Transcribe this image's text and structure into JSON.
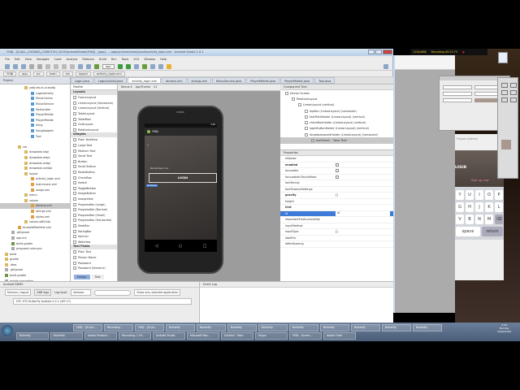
{
  "window": {
    "title": "YOBJ - [D:\\ALL_CODING\\_CODE\\TUH_2015\\AndroidStudio\\YOBJ] - [app] - ...\\app\\src\\main\\res\\layout\\activity_login.xml - Android Studio 1.0.1"
  },
  "menu": [
    "File",
    "Edit",
    "View",
    "Navigate",
    "Code",
    "Analyze",
    "Refactor",
    "Build",
    "Run",
    "Tools",
    "VCS",
    "Window",
    "Help"
  ],
  "toolbar": {
    "run_config": "app"
  },
  "breadcrumb": [
    "YOBJ",
    "app",
    "src",
    "main",
    "res",
    "layout",
    "activity_login.xml"
  ],
  "editor_tabs": [
    {
      "label": "Login.java",
      "active": false
    },
    {
      "label": "LoginActivity.java",
      "active": false
    },
    {
      "label": "activity_login.xml",
      "active": true
    },
    {
      "label": "dimens.xml",
      "active": false
    },
    {
      "label": "strings.xml",
      "active": false
    },
    {
      "label": "MusicService.java",
      "active": false
    },
    {
      "label": "PlayerMiddle.java",
      "active": false
    },
    {
      "label": "PlayerMiddle.java",
      "active": false
    },
    {
      "label": "Tool.java",
      "active": false
    }
  ],
  "project": {
    "header": "Project",
    "items": [
      {
        "label": "yobj.ew.cs.ui.eyobj",
        "depth": 3,
        "type": "folder"
      },
      {
        "label": "LoginActivity",
        "depth": 4,
        "type": "class"
      },
      {
        "label": "MusicCenter",
        "depth": 4,
        "type": "class"
      },
      {
        "label": "MusicService",
        "depth": 4,
        "type": "class"
      },
      {
        "label": "MyHandler",
        "depth": 4,
        "type": "class"
      },
      {
        "label": "PlayerMiddle",
        "depth": 4,
        "type": "class"
      },
      {
        "label": "PlayerMiddle",
        "depth": 4,
        "type": "class"
      },
      {
        "label": "Song",
        "depth": 4,
        "type": "class"
      },
      {
        "label": "SongAdapter",
        "depth": 4,
        "type": "class"
      },
      {
        "label": "Tool",
        "depth": 4,
        "type": "class"
      },
      {
        "label": "",
        "depth": 0,
        "type": "spacer"
      },
      {
        "label": "res",
        "depth": 2,
        "type": "folder"
      },
      {
        "label": "drawable-hdpi",
        "depth": 3,
        "type": "folder"
      },
      {
        "label": "drawable-mdpi",
        "depth": 3,
        "type": "folder"
      },
      {
        "label": "drawable-xhdpi",
        "depth": 3,
        "type": "folder"
      },
      {
        "label": "drawable-xxhdpi",
        "depth": 3,
        "type": "folder"
      },
      {
        "label": "layout",
        "depth": 3,
        "type": "folder"
      },
      {
        "label": "activity_login.xml",
        "depth": 4,
        "type": "xml"
      },
      {
        "label": "mainmusic.xml",
        "depth": 4,
        "type": "xml"
      },
      {
        "label": "songs.xml",
        "depth": 4,
        "type": "xml"
      },
      {
        "label": "menu",
        "depth": 3,
        "type": "folder"
      },
      {
        "label": "values",
        "depth": 3,
        "type": "folder"
      },
      {
        "label": "dimens.xml",
        "depth": 4,
        "type": "xml",
        "selected": true
      },
      {
        "label": "strings.xml",
        "depth": 4,
        "type": "xml"
      },
      {
        "label": "styles.xml",
        "depth": 4,
        "type": "xml"
      },
      {
        "label": "values-w820dp",
        "depth": 3,
        "type": "folder"
      },
      {
        "label": "AndroidManifest.xml",
        "depth": 2,
        "type": "xml"
      },
      {
        "label": ".gitignore",
        "depth": 1,
        "type": "file"
      },
      {
        "label": "app.iml",
        "depth": 1,
        "type": "file"
      },
      {
        "label": "build.gradle",
        "depth": 1,
        "type": "gradle"
      },
      {
        "label": "proguard-rules.pro",
        "depth": 1,
        "type": "file"
      },
      {
        "label": "build",
        "depth": 0,
        "type": "folder"
      },
      {
        "label": "gradle",
        "depth": 0,
        "type": "folder"
      },
      {
        "label": ".idea",
        "depth": 0,
        "type": "folder"
      },
      {
        "label": ".gitignore",
        "depth": 0,
        "type": "file"
      },
      {
        "label": "build.gradle",
        "depth": 0,
        "type": "gradle"
      },
      {
        "label": "gradle.properties",
        "depth": 0,
        "type": "file"
      },
      {
        "label": "gradlew",
        "depth": 0,
        "type": "file"
      }
    ]
  },
  "palette": {
    "header": "Palette",
    "sections": [
      {
        "title": "Layouts",
        "items": [
          "FrameLayout",
          "LinearLayout (Horizontal)",
          "LinearLayout (Vertical)",
          "TableLayout",
          "TableRow",
          "GridLayout",
          "RelativeLayout"
        ]
      },
      {
        "title": "Widgets",
        "items": [
          "Plain TextView",
          "Large Text",
          "Medium Text",
          "Small Text",
          "Button",
          "Small Button",
          "RadioButton",
          "CheckBox",
          "Switch",
          "ToggleButton",
          "ImageButton",
          "ImageView",
          "ProgressBar (Large)",
          "ProgressBar (Normal)",
          "ProgressBar (Small)",
          "ProgressBar (Horizontal)",
          "SeekBar",
          "RatingBar",
          "Spinner",
          "WebView"
        ]
      },
      {
        "title": "Text Fields",
        "items": [
          "Plain Text",
          "Person Name",
          "Password",
          "Password (Numeric)"
        ]
      }
    ]
  },
  "design_tabs": [
    "Design",
    "Text"
  ],
  "canvas": {
    "device": "Nexus 4",
    "theme": "AppTheme",
    "api": "21"
  },
  "phone": {
    "status_time": "5:00",
    "app_title": "YOBJ",
    "remember": "Remember me",
    "login": "LOGIN",
    "selected_badge": "textView2"
  },
  "component_tree": {
    "header": "Component Tree",
    "items": [
      {
        "label": "Device Screen",
        "depth": 0
      },
      {
        "label": "RelativeLayout",
        "depth": 1
      },
      {
        "label": "LinearLayout (vertical)",
        "depth": 2
      },
      {
        "label": "topBar (LinearLayout) (horizontal)",
        "depth": 3
      },
      {
        "label": "textFieldHolder (LinearLayout) (vertical)",
        "depth": 3
      },
      {
        "label": "checkBoxHolder (LinearLayout) (vertical)",
        "depth": 3
      },
      {
        "label": "loginButtonHolder (LinearLayout) (vertical)",
        "depth": 3
      },
      {
        "label": "forgetpasswordHolder (LinearLayout) (horizontal)",
        "depth": 3
      },
      {
        "label": "textView2 - \"New Text\"",
        "depth": 4,
        "selected": true
      }
    ]
  },
  "properties": {
    "header": "Properties",
    "rows": [
      {
        "key": "ellipsize",
        "value": "",
        "type": "text"
      },
      {
        "key": "enabled",
        "value": "",
        "type": "check",
        "bold": true
      },
      {
        "key": "focusable",
        "value": "",
        "type": "check"
      },
      {
        "key": "focusableInTouchMode",
        "value": "",
        "type": "check"
      },
      {
        "key": "fontFamily",
        "value": "",
        "type": "text"
      },
      {
        "key": "fontFeatureSettings",
        "value": "",
        "type": "text"
      },
      {
        "key": "gravity",
        "value": "[]",
        "type": "text",
        "bold": true
      },
      {
        "key": "height",
        "value": "",
        "type": "text"
      },
      {
        "key": "hint",
        "value": "",
        "type": "text",
        "bold": true
      },
      {
        "key": "id",
        "value": "id",
        "type": "text",
        "selected": true
      },
      {
        "key": "importantForAccessibility",
        "value": "",
        "type": "text"
      },
      {
        "key": "inputMethod",
        "value": "",
        "type": "text"
      },
      {
        "key": "inputType",
        "value": "[]",
        "type": "text"
      },
      {
        "key": "labelFor",
        "value": "",
        "type": "text"
      },
      {
        "key": "letterSpacing",
        "value": "",
        "type": "text"
      }
    ]
  },
  "android_panel": {
    "header": "Android DDMS",
    "devices_tab": "Devices | logcat",
    "adb_logs": "ADB logs",
    "log_level_label": "Log level:",
    "log_level": "Verbose",
    "filter": "",
    "app_filter": "Show only selected application",
    "device_selector": "HTC HTC Butterfly Android 4.2.2 (API 17)"
  },
  "event_log": {
    "header": "Event Log"
  },
  "recorder": {
    "resolution": "1220x688",
    "status": "Recording 00:22:73"
  },
  "mockup": {
    "forgot": "Forgot Address",
    "login": "LOGIN",
    "signup": "Sign up now",
    "rows": [
      [
        "Y",
        "U",
        "I",
        "O",
        "P"
      ],
      [
        "G",
        "H",
        "J",
        "K",
        "L"
      ],
      [
        "V",
        "B",
        "N",
        "M"
      ]
    ],
    "space": "space",
    "return": "return"
  },
  "taskbar": {
    "row1": [
      "YOBJ - [D:\\ALL...",
      "Recording",
      "YOBJ - [D:\\AL...",
      "Butterfly",
      "Butterfly",
      "Butterfly",
      "Butterfly",
      "Butterfly",
      "Butterfly",
      "Butterfly",
      "Butterfly",
      "Butterfly"
    ],
    "row2": [
      "Butterfly",
      "Butterfly",
      "Adobe Photosh...",
      "Recording: 1.54...",
      "Android Studio",
      "Microsoft Wor...",
      "Untitled - Paint",
      "Skype",
      "YOBJ - Screen...",
      "Adobe Flash"
    ],
    "clock_time": "4:04",
    "clock_day": "Monday",
    "clock_date": "16/02/2015"
  },
  "colors": {
    "selection": "#3d7bd8",
    "titlebar": "#c7d9ee",
    "canvas": "#9c9c9c",
    "login_border": "#dddddd"
  }
}
